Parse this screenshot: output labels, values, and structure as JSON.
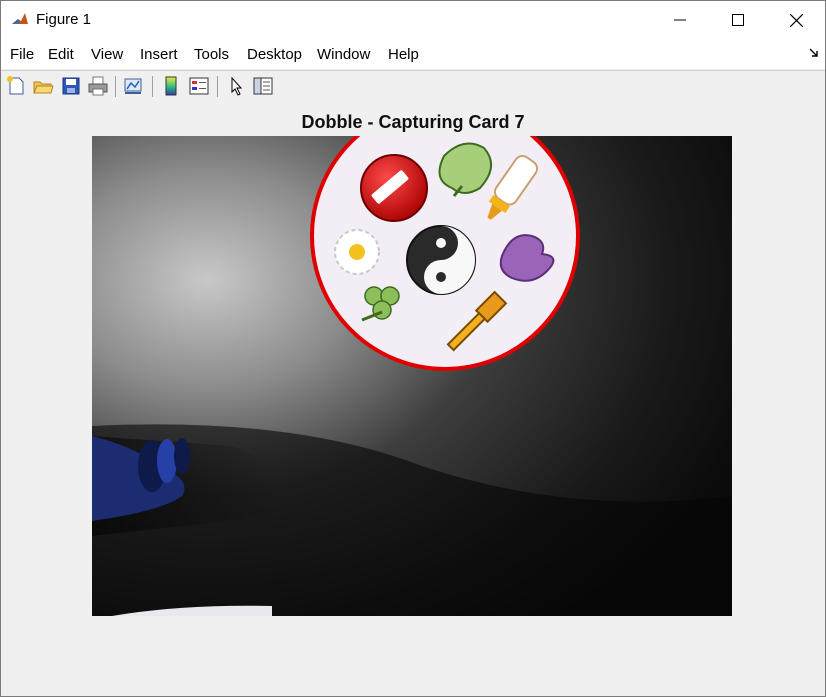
{
  "window": {
    "title": "Figure 1"
  },
  "menu": [
    "File",
    "Edit",
    "View",
    "Insert",
    "Tools",
    "Desktop",
    "Window",
    "Help"
  ],
  "toolbar": {
    "icons": [
      "new-figure-icon",
      "open-file-icon",
      "save-icon",
      "print-icon",
      "link-plot-icon",
      "insert-colorbar-icon",
      "insert-legend-icon",
      "edit-plot-icon",
      "property-inspector-icon"
    ]
  },
  "figure": {
    "title": "Dobble - Capturing Card 7"
  },
  "colors": {
    "card_border": "#e00000",
    "background": "#f0f0f0"
  }
}
